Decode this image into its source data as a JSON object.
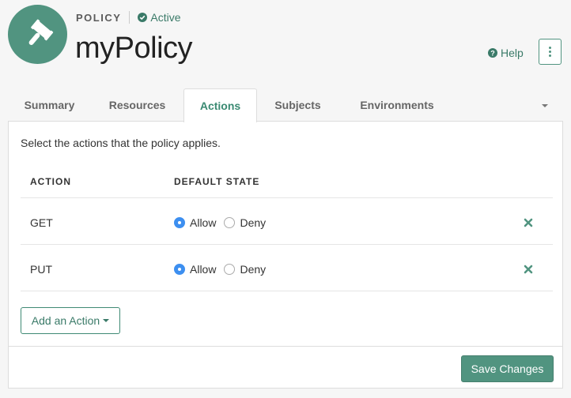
{
  "header": {
    "type_label": "POLICY",
    "status": "Active",
    "title": "myPolicy",
    "help_label": "Help",
    "avatar_icon": "gavel-icon",
    "more_icon": "kebab-menu-icon"
  },
  "tabs": [
    {
      "label": "Summary",
      "active": false
    },
    {
      "label": "Resources",
      "active": false
    },
    {
      "label": "Actions",
      "active": true
    },
    {
      "label": "Subjects",
      "active": false
    },
    {
      "label": "Environments",
      "active": false
    }
  ],
  "panel": {
    "intro": "Select the actions that the policy applies.",
    "columns": {
      "action": "ACTION",
      "default_state": "DEFAULT STATE"
    },
    "rows": [
      {
        "action": "GET",
        "allow_label": "Allow",
        "deny_label": "Deny",
        "state": "Allow"
      },
      {
        "action": "PUT",
        "allow_label": "Allow",
        "deny_label": "Deny",
        "state": "Allow"
      }
    ],
    "add_button": "Add an Action",
    "save_button": "Save Changes"
  },
  "colors": {
    "brand": "#519480",
    "radio_checked": "#3d8ff0"
  }
}
